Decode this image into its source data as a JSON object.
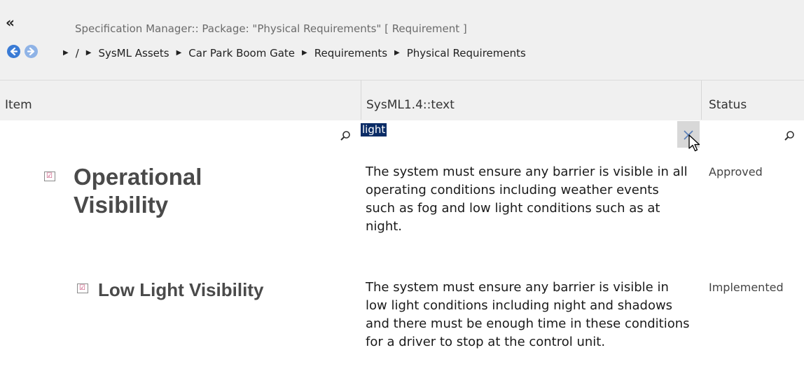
{
  "toolbar": {
    "collapse_glyph": "«",
    "title": "Specification Manager::  Package: \"Physical Requirements\"  [ Requirement ]"
  },
  "breadcrumb": {
    "root": "/",
    "items": [
      "SysML Assets",
      "Car Park Boom Gate",
      "Requirements",
      "Physical Requirements"
    ]
  },
  "columns": {
    "item": "Item",
    "text": "SysML1.4::text",
    "status": "Status"
  },
  "filter": {
    "text_value": "light"
  },
  "rows": [
    {
      "title_line1": "Operational",
      "title_line2": "Visibility",
      "text": "The system must ensure any barrier is visible in all operating conditions including weather events such as fog and low light conditions such as at night.",
      "status": "Approved"
    },
    {
      "title": "Low Light Visibility",
      "text": "The system must ensure any barrier is visible in low light conditions including night and shadows and there must be enough time in these conditions for a driver to stop at the control unit.",
      "status": "Implemented"
    }
  ],
  "colors": {
    "accent": "#3a7bd5",
    "selection": "#0b2c66",
    "header_bg": "#f0f0f0"
  }
}
